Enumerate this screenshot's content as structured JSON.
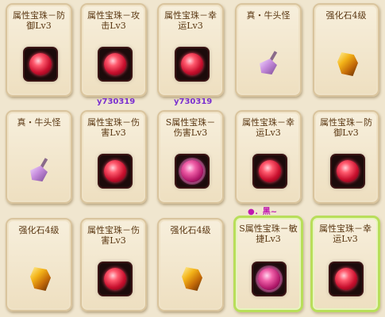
{
  "items": [
    {
      "name": "属性宝珠－防御Lv3",
      "icon": "red-orb-icon"
    },
    {
      "name": "属性宝珠－攻击Lv3",
      "icon": "red-orb-icon"
    },
    {
      "name": "属性宝珠－幸运Lv3",
      "icon": "red-orb-icon"
    },
    {
      "name": "真・牛头怪",
      "icon": "axe-horn-icon"
    },
    {
      "name": "强化石4级",
      "icon": "gold-stone-icon"
    },
    {
      "name": "真・牛头怪",
      "icon": "axe-horn-icon"
    },
    {
      "name": "属性宝珠－伤害Lv3",
      "icon": "red-orb-icon"
    },
    {
      "name": "S属性宝珠－伤害Lv3",
      "icon": "pink-orb-icon"
    },
    {
      "name": "属性宝珠－幸运Lv3",
      "icon": "red-orb-icon"
    },
    {
      "name": "属性宝珠－防御Lv3",
      "icon": "red-orb-icon"
    },
    {
      "name": "强化石4级",
      "icon": "gold-stone-icon"
    },
    {
      "name": "属性宝珠－伤害Lv3",
      "icon": "red-orb-icon"
    },
    {
      "name": "强化石4级",
      "icon": "gold-stone-icon"
    },
    {
      "name": "S属性宝珠－敏捷Lv3",
      "icon": "pink-orb-icon"
    },
    {
      "name": "属性宝珠－幸运Lv3",
      "icon": "red-orb-icon"
    }
  ],
  "players": [
    {
      "name": "y730319"
    },
    {
      "name": "y730319"
    }
  ],
  "badge": "●．黑~",
  "colors": {
    "background": "#f0e6cf",
    "selected_border": "#b8de5a",
    "player_name": "#7a2fcf"
  }
}
